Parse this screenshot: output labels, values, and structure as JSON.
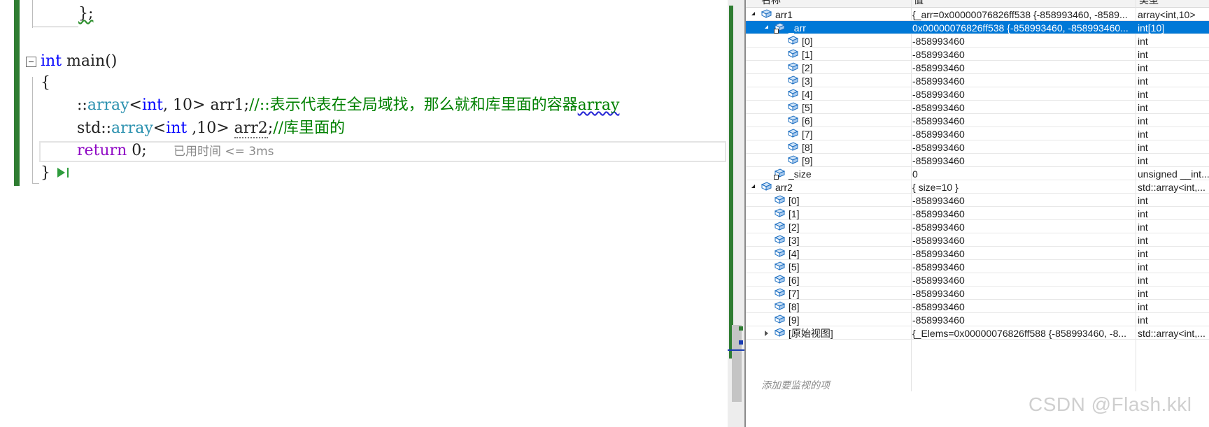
{
  "editor": {
    "lines": [
      {
        "id": "struct-end",
        "tokens": [
          {
            "t": "};",
            "cls": "squiggle-green"
          }
        ]
      },
      {
        "id": "main-decl",
        "tokens": [
          {
            "t": "int",
            "cls": "kw"
          },
          {
            "t": " main()",
            "cls": ""
          }
        ]
      },
      {
        "id": "open-brace",
        "tokens": [
          {
            "t": "{",
            "cls": ""
          }
        ]
      },
      {
        "id": "arr1-decl",
        "tokens": [
          {
            "t": "::",
            "cls": ""
          },
          {
            "t": "array",
            "cls": "type"
          },
          {
            "t": "<",
            "cls": ""
          },
          {
            "t": "int",
            "cls": "kw"
          },
          {
            "t": ", 10> ",
            "cls": ""
          },
          {
            "t": "arr1",
            "cls": ""
          },
          {
            "t": ";",
            "cls": ""
          },
          {
            "t": "//::表示代表在全局域找，那么就和库里面的容器",
            "cls": "cm"
          },
          {
            "t": "array",
            "cls": "cm squiggle-blue"
          }
        ]
      },
      {
        "id": "arr2-decl",
        "tokens": [
          {
            "t": "std::",
            "cls": ""
          },
          {
            "t": "array",
            "cls": "type"
          },
          {
            "t": "<",
            "cls": ""
          },
          {
            "t": "int",
            "cls": "kw"
          },
          {
            "t": " ,10> ",
            "cls": ""
          },
          {
            "t": "arr2",
            "cls": "dotted"
          },
          {
            "t": ";",
            "cls": ""
          },
          {
            "t": "//库里面的",
            "cls": "cm"
          }
        ]
      },
      {
        "id": "return-stmt",
        "tokens": [
          {
            "t": "return",
            "cls": "ret"
          },
          {
            "t": " 0;",
            "cls": ""
          }
        ]
      },
      {
        "id": "close-brace",
        "tokens": [
          {
            "t": "}",
            "cls": ""
          }
        ]
      }
    ],
    "timing_hint": "已用时间 <= 3ms"
  },
  "watch": {
    "columns": {
      "name": "名称",
      "value": "值",
      "type": "类型"
    },
    "rows": [
      {
        "indent": 0,
        "expander": "open",
        "icon": "object-icon",
        "lock": false,
        "name": "arr1",
        "value": "{_arr=0x00000076826ff538 {-858993460, -8589...",
        "type": "array<int,10>",
        "selected": false
      },
      {
        "indent": 1,
        "expander": "open",
        "icon": "object-icon",
        "lock": true,
        "name": "_arr",
        "value": "0x00000076826ff538 {-858993460, -858993460...",
        "type": "int[10]",
        "selected": true
      },
      {
        "indent": 2,
        "expander": "none",
        "icon": "object-icon",
        "lock": false,
        "name": "[0]",
        "value": "-858993460",
        "type": "int",
        "selected": false
      },
      {
        "indent": 2,
        "expander": "none",
        "icon": "object-icon",
        "lock": false,
        "name": "[1]",
        "value": "-858993460",
        "type": "int",
        "selected": false
      },
      {
        "indent": 2,
        "expander": "none",
        "icon": "object-icon",
        "lock": false,
        "name": "[2]",
        "value": "-858993460",
        "type": "int",
        "selected": false
      },
      {
        "indent": 2,
        "expander": "none",
        "icon": "object-icon",
        "lock": false,
        "name": "[3]",
        "value": "-858993460",
        "type": "int",
        "selected": false
      },
      {
        "indent": 2,
        "expander": "none",
        "icon": "object-icon",
        "lock": false,
        "name": "[4]",
        "value": "-858993460",
        "type": "int",
        "selected": false
      },
      {
        "indent": 2,
        "expander": "none",
        "icon": "object-icon",
        "lock": false,
        "name": "[5]",
        "value": "-858993460",
        "type": "int",
        "selected": false
      },
      {
        "indent": 2,
        "expander": "none",
        "icon": "object-icon",
        "lock": false,
        "name": "[6]",
        "value": "-858993460",
        "type": "int",
        "selected": false
      },
      {
        "indent": 2,
        "expander": "none",
        "icon": "object-icon",
        "lock": false,
        "name": "[7]",
        "value": "-858993460",
        "type": "int",
        "selected": false
      },
      {
        "indent": 2,
        "expander": "none",
        "icon": "object-icon",
        "lock": false,
        "name": "[8]",
        "value": "-858993460",
        "type": "int",
        "selected": false
      },
      {
        "indent": 2,
        "expander": "none",
        "icon": "object-icon",
        "lock": false,
        "name": "[9]",
        "value": "-858993460",
        "type": "int",
        "selected": false
      },
      {
        "indent": 1,
        "expander": "none",
        "icon": "object-icon",
        "lock": true,
        "name": "_size",
        "value": "0",
        "type": "unsigned __int...",
        "selected": false
      },
      {
        "indent": 0,
        "expander": "open",
        "icon": "object-icon",
        "lock": false,
        "name": "arr2",
        "value": "{ size=10 }",
        "type": "std::array<int,...",
        "selected": false
      },
      {
        "indent": 1,
        "expander": "none",
        "icon": "object-icon",
        "lock": false,
        "name": "[0]",
        "value": "-858993460",
        "type": "int",
        "selected": false
      },
      {
        "indent": 1,
        "expander": "none",
        "icon": "object-icon",
        "lock": false,
        "name": "[1]",
        "value": "-858993460",
        "type": "int",
        "selected": false
      },
      {
        "indent": 1,
        "expander": "none",
        "icon": "object-icon",
        "lock": false,
        "name": "[2]",
        "value": "-858993460",
        "type": "int",
        "selected": false
      },
      {
        "indent": 1,
        "expander": "none",
        "icon": "object-icon",
        "lock": false,
        "name": "[3]",
        "value": "-858993460",
        "type": "int",
        "selected": false
      },
      {
        "indent": 1,
        "expander": "none",
        "icon": "object-icon",
        "lock": false,
        "name": "[4]",
        "value": "-858993460",
        "type": "int",
        "selected": false
      },
      {
        "indent": 1,
        "expander": "none",
        "icon": "object-icon",
        "lock": false,
        "name": "[5]",
        "value": "-858993460",
        "type": "int",
        "selected": false
      },
      {
        "indent": 1,
        "expander": "none",
        "icon": "object-icon",
        "lock": false,
        "name": "[6]",
        "value": "-858993460",
        "type": "int",
        "selected": false
      },
      {
        "indent": 1,
        "expander": "none",
        "icon": "object-icon",
        "lock": false,
        "name": "[7]",
        "value": "-858993460",
        "type": "int",
        "selected": false
      },
      {
        "indent": 1,
        "expander": "none",
        "icon": "object-icon",
        "lock": false,
        "name": "[8]",
        "value": "-858993460",
        "type": "int",
        "selected": false
      },
      {
        "indent": 1,
        "expander": "none",
        "icon": "object-icon",
        "lock": false,
        "name": "[9]",
        "value": "-858993460",
        "type": "int",
        "selected": false
      },
      {
        "indent": 1,
        "expander": "closed",
        "icon": "object-icon",
        "lock": false,
        "name": "[原始视图]",
        "value": "{_Elems=0x00000076826ff588 {-858993460, -8...",
        "type": "std::array<int,...",
        "selected": false
      }
    ],
    "add_item_placeholder": "添加要监视的项"
  },
  "watermark": "CSDN @Flash.kkl"
}
